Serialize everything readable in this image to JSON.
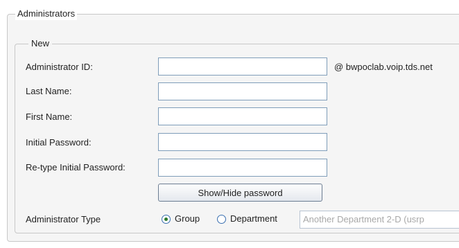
{
  "section": {
    "title": "Administrators",
    "subsection_title": "New"
  },
  "form": {
    "admin_id_label": "Administrator ID:",
    "admin_id_value": "",
    "domain_suffix": "@ bwpoclab.voip.tds.net",
    "last_name_label": "Last Name:",
    "last_name_value": "",
    "first_name_label": "First Name:",
    "first_name_value": "",
    "initial_password_label": "Initial Password:",
    "initial_password_value": "",
    "retype_password_label": "Re-type Initial Password:",
    "retype_password_value": "",
    "show_hide_button": "Show/Hide password",
    "admin_type_label": "Administrator Type",
    "admin_type_options": [
      "Group",
      "Department"
    ],
    "admin_type_selected": "Group",
    "department_select_value": "Another Department 2-D (usrp"
  },
  "colors": {
    "panel_background": "#f5f5f5",
    "border": "#c8c8c8",
    "input_border": "#7f9db9",
    "radio_selected": "#2a7a2a",
    "disabled_text": "#a8a8a8"
  }
}
